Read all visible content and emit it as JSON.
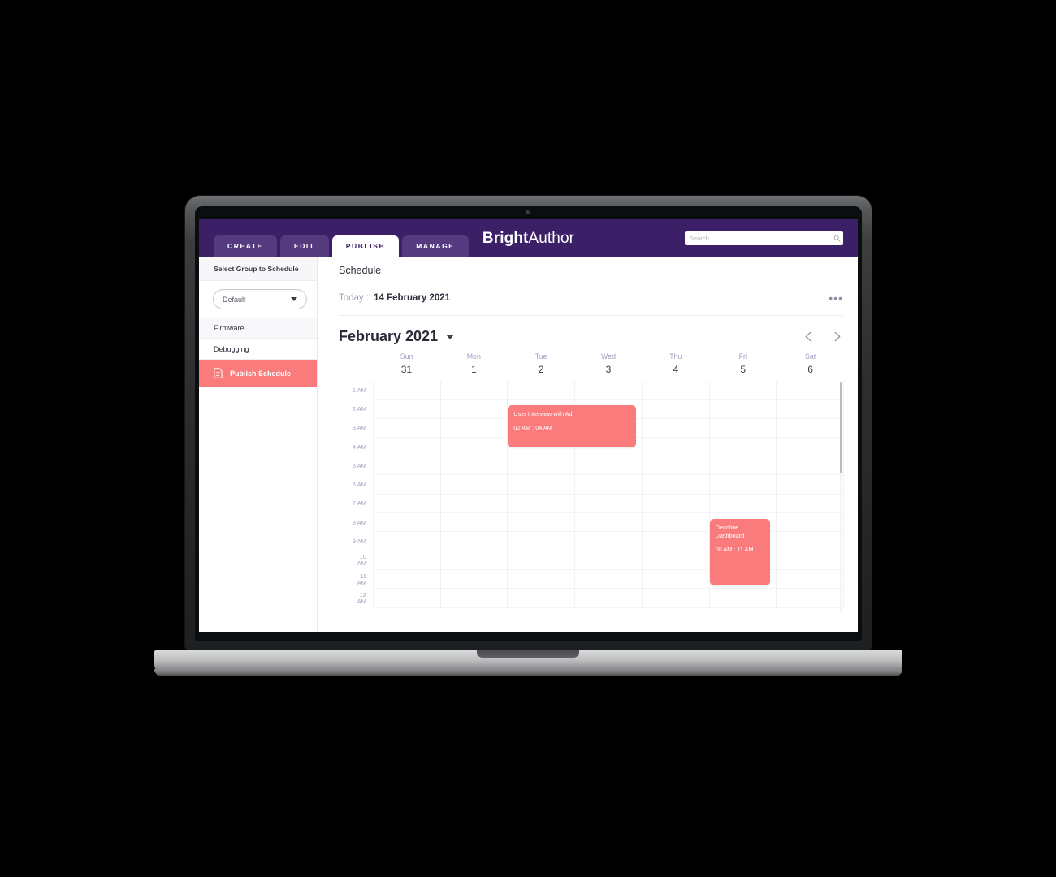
{
  "topnav": {
    "tabs": [
      {
        "label": "CREATE",
        "active": false
      },
      {
        "label": "EDIT",
        "active": false
      },
      {
        "label": "PUBLISH",
        "active": true
      },
      {
        "label": "MANAGE",
        "active": false
      }
    ],
    "brand_bold": "Bright",
    "brand_light": "Author",
    "search": {
      "placeholder": "Search",
      "value": "",
      "icon": "search-icon"
    }
  },
  "sidebar": {
    "heading": "Select Group to Schedule",
    "group_select": {
      "value": "Default",
      "icon": "chevron-down-icon"
    },
    "items": [
      {
        "label": "Firmware",
        "active": false,
        "icon": null
      },
      {
        "label": "Debugging",
        "active": false,
        "icon": null
      },
      {
        "label": "Publish Schedule",
        "active": true,
        "icon": "document-icon"
      }
    ]
  },
  "main": {
    "page_title": "Schedule",
    "today_label": "Today :",
    "today_date": "14 February 2021",
    "overflow_menu": "•••",
    "month_title": "February 2021",
    "month_caret": "chevron-down-icon",
    "prev_label": "chevron-left-icon",
    "next_label": "chevron-right-icon"
  },
  "calendar": {
    "days": [
      {
        "name": "Sun",
        "num": "31"
      },
      {
        "name": "Mon",
        "num": "1"
      },
      {
        "name": "Tue",
        "num": "2"
      },
      {
        "name": "Wed",
        "num": "3"
      },
      {
        "name": "Thu",
        "num": "4"
      },
      {
        "name": "Fri",
        "num": "5"
      },
      {
        "name": "Sat",
        "num": "6"
      }
    ],
    "times": [
      "1 AM",
      "2 AM",
      "3 AM",
      "4 AM",
      "5 AM",
      "6 AM",
      "7 AM",
      "8 AM",
      "9 AM",
      "10 AM",
      "11 AM",
      "12 AM"
    ],
    "events": [
      {
        "title": "User Interview with Adi",
        "time": "02 AM : 04 AM",
        "day_index": 2,
        "start_hour_index": 1,
        "span_hours": 2.2,
        "color": "#fa7b7b"
      },
      {
        "title": "Deadline Dashboard",
        "time": "08 AM : 11 AM",
        "day_index": 5,
        "start_hour_index": 7,
        "span_hours": 3.5,
        "color": "#fa7b7b"
      }
    ]
  },
  "theme": {
    "nav_purple": "#3b2068",
    "tab_purple": "#553a80",
    "accent_red": "#fa7b7b",
    "muted_purple": "#a09ec0"
  }
}
